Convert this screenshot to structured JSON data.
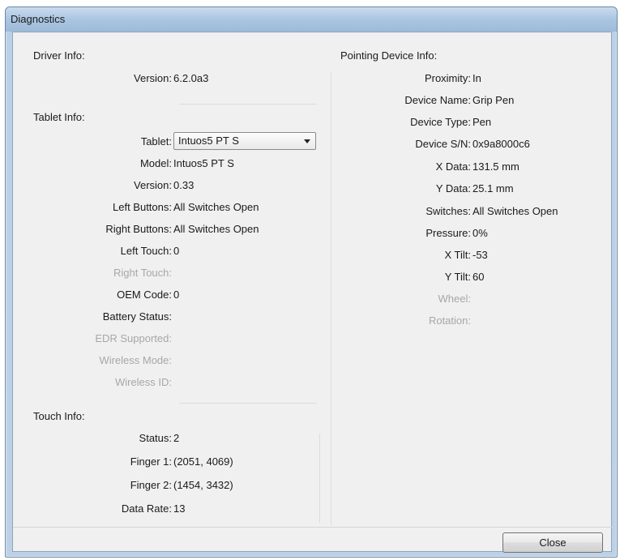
{
  "window": {
    "title": "Diagnostics"
  },
  "driver_info": {
    "heading": "Driver Info:",
    "version_label": "Version:",
    "version_value": "6.2.0a3"
  },
  "tablet_info": {
    "heading": "Tablet Info:",
    "tablet_label": "Tablet:",
    "tablet_selected": "Intuos5 PT S",
    "model_label": "Model:",
    "model_value": "Intuos5 PT S",
    "version_label": "Version:",
    "version_value": "0.33",
    "left_buttons_label": "Left Buttons:",
    "left_buttons_value": "All Switches Open",
    "right_buttons_label": "Right Buttons:",
    "right_buttons_value": "All Switches Open",
    "left_touch_label": "Left Touch:",
    "left_touch_value": "0",
    "right_touch_label": "Right Touch:",
    "oem_code_label": "OEM Code:",
    "oem_code_value": "0",
    "battery_status_label": "Battery Status:",
    "edr_supported_label": "EDR Supported:",
    "wireless_mode_label": "Wireless Mode:",
    "wireless_id_label": "Wireless ID:"
  },
  "touch_info": {
    "heading": "Touch Info:",
    "status_label": "Status:",
    "status_value": "2",
    "finger1_label": "Finger 1:",
    "finger1_value": "(2051, 4069)",
    "finger2_label": "Finger 2:",
    "finger2_value": "(1454, 3432)",
    "data_rate_label": "Data Rate:",
    "data_rate_value": "13"
  },
  "pointing_device_info": {
    "heading": "Pointing Device Info:",
    "proximity_label": "Proximity:",
    "proximity_value": "In",
    "device_name_label": "Device Name:",
    "device_name_value": "Grip Pen",
    "device_type_label": "Device Type:",
    "device_type_value": "Pen",
    "device_sn_label": "Device S/N:",
    "device_sn_value": "0x9a8000c6",
    "x_data_label": "X Data:",
    "x_data_value": "131.5 mm",
    "y_data_label": "Y Data:",
    "y_data_value": "25.1 mm",
    "switches_label": "Switches:",
    "switches_value": "All Switches Open",
    "pressure_label": "Pressure:",
    "pressure_value": "0%",
    "x_tilt_label": "X Tilt:",
    "x_tilt_value": "-53",
    "y_tilt_label": "Y Tilt:",
    "y_tilt_value": "60",
    "wheel_label": "Wheel:",
    "rotation_label": "Rotation:"
  },
  "footer": {
    "close_label": "Close"
  }
}
